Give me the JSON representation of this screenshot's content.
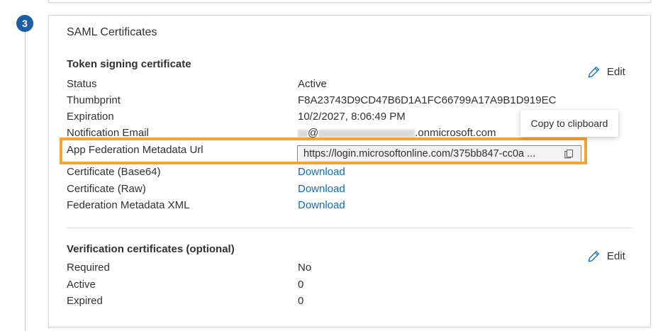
{
  "step": {
    "number": "3"
  },
  "card": {
    "title": "SAML Certificates",
    "token_section": {
      "title": "Token signing certificate",
      "edit_label": "Edit",
      "rows": [
        {
          "label": "Status",
          "value": "Active"
        },
        {
          "label": "Thumbprint",
          "value": "F8A23743D9CD47B6D1A1FC66799A17A9B1D919EC"
        },
        {
          "label": "Expiration",
          "value": "10/2/2027, 8:06:49 PM"
        },
        {
          "label": "Notification Email",
          "value_at": "@",
          "value_domain": ".onmicrosoft.com"
        },
        {
          "label": "App Federation Metadata Url",
          "value": "https://login.microsoftonline.com/375bb847-cc0a ..."
        },
        {
          "label": "Certificate (Base64)",
          "value": "Download"
        },
        {
          "label": "Certificate (Raw)",
          "value": "Download"
        },
        {
          "label": "Federation Metadata XML",
          "value": "Download"
        }
      ]
    },
    "verification_section": {
      "title": "Verification certificates (optional)",
      "edit_label": "Edit",
      "rows": [
        {
          "label": "Required",
          "value": "No"
        },
        {
          "label": "Active",
          "value": "0"
        },
        {
          "label": "Expired",
          "value": "0"
        }
      ]
    }
  },
  "tooltip": {
    "text": "Copy to clipboard"
  },
  "icons": {
    "edit": "pencil-icon",
    "copy": "copy-icon"
  },
  "colors": {
    "link": "#0f6cbd",
    "step_badge": "#1d5ea8",
    "highlight": "#f6a42d"
  }
}
